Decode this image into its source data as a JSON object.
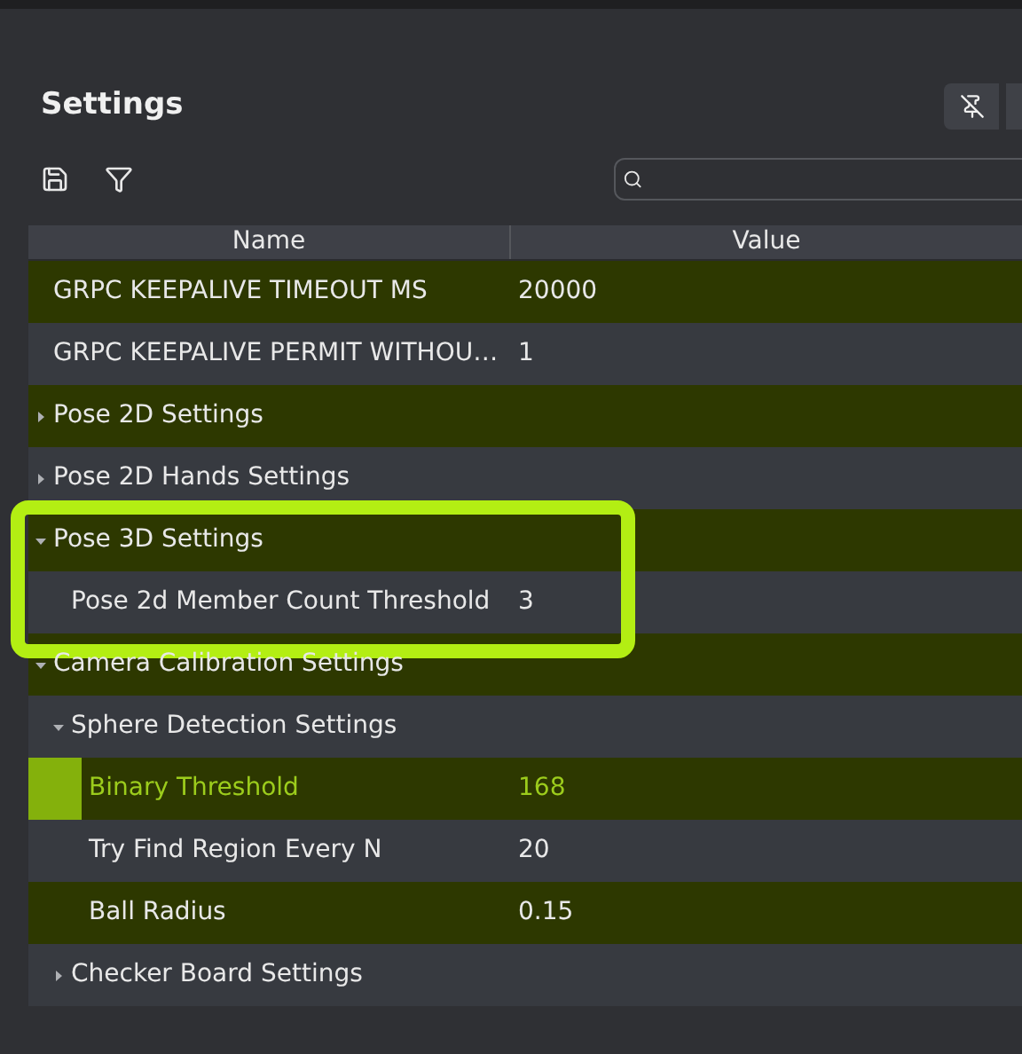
{
  "panel": {
    "title": "Settings"
  },
  "table": {
    "columns": [
      "Name",
      "Value"
    ],
    "rows": [
      {
        "name": "GRPC KEEPALIVE TIMEOUT MS",
        "value": "20000",
        "selected": false
      },
      {
        "name": "GRPC KEEPALIVE PERMIT WITHOU…",
        "value": "1",
        "selected": false
      },
      {
        "name": "Pose 2D Settings",
        "selected": false,
        "expanded": false
      },
      {
        "name": "Pose 2D Hands Settings",
        "selected": false,
        "expanded": false
      },
      {
        "name": "Pose 3D Settings",
        "selected": false,
        "expanded": true,
        "highlighted": true,
        "children": [
          {
            "name": "Pose 2d Member Count Threshold",
            "value": "3",
            "selected": false
          }
        ]
      },
      {
        "name": "Camera Calibration Settings",
        "selected": false,
        "expanded": true,
        "children": [
          {
            "name": "Sphere Detection Settings",
            "selected": false,
            "expanded": true,
            "children": [
              {
                "name": "Binary Threshold",
                "value": "168",
                "selected": true
              },
              {
                "name": "Try Find Region Every N",
                "value": "20",
                "selected": false
              },
              {
                "name": "Ball Radius",
                "value": "0.15",
                "selected": false
              }
            ]
          },
          {
            "name": "Checker Board Settings",
            "selected": false,
            "expanded": false
          }
        ]
      }
    ]
  }
}
